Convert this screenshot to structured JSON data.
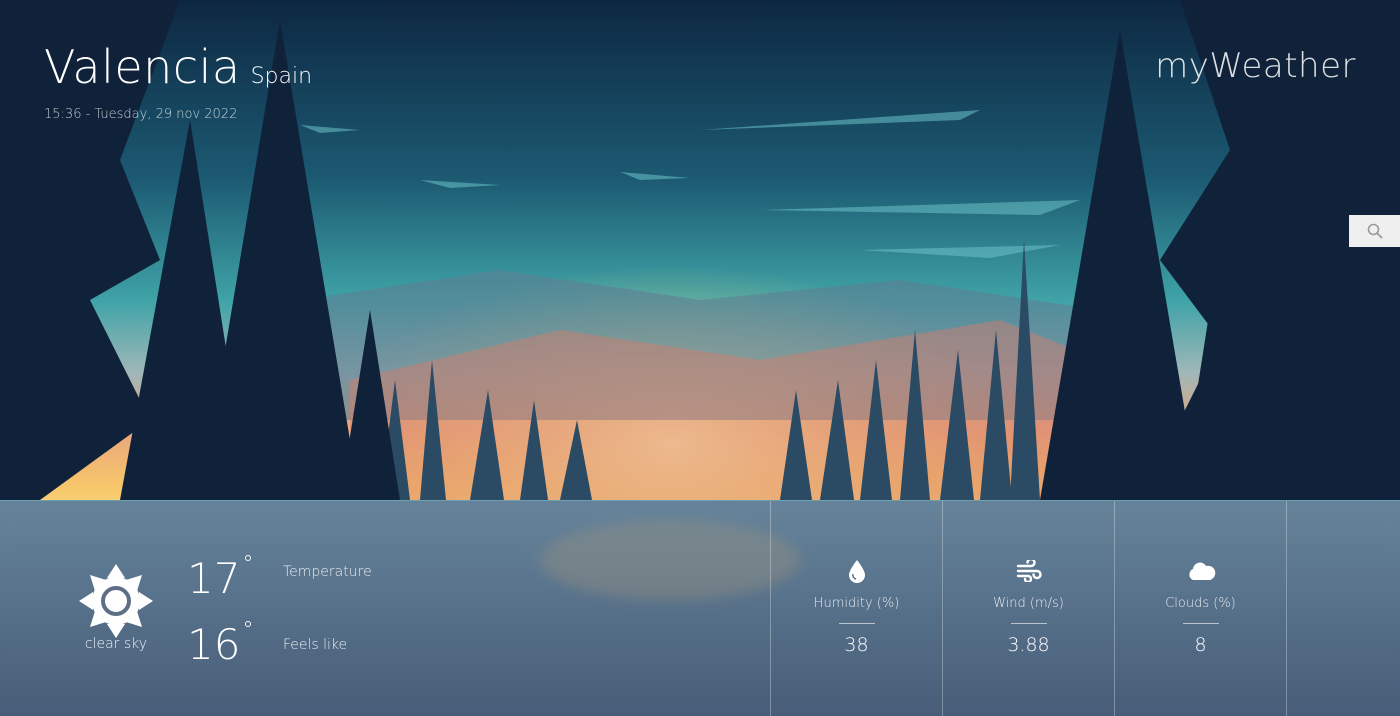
{
  "location": {
    "city": "Valencia",
    "country": "Spain",
    "datetime": "15:36 - Tuesday, 29 nov 2022"
  },
  "brand": "myWeather",
  "search": {
    "icon": "search-icon"
  },
  "current": {
    "condition": "clear sky",
    "condition_icon": "sun-icon",
    "temperature": "17",
    "temperature_label": "Temperature",
    "feels_like": "16",
    "feels_like_label": "Feels like",
    "degree_symbol": "°"
  },
  "stats": [
    {
      "label": "Humidity (%)",
      "value": "38",
      "icon": "droplet-icon"
    },
    {
      "label": "Wind (m/s)",
      "value": "3.88",
      "icon": "wind-icon"
    },
    {
      "label": "Clouds (%)",
      "value": "8",
      "icon": "cloud-icon"
    }
  ],
  "colors": {
    "sky_top": "#0d2742",
    "sky_mid": "#2f8fa0",
    "sunset": "#f6c46a",
    "panel": "#5f6e87"
  }
}
